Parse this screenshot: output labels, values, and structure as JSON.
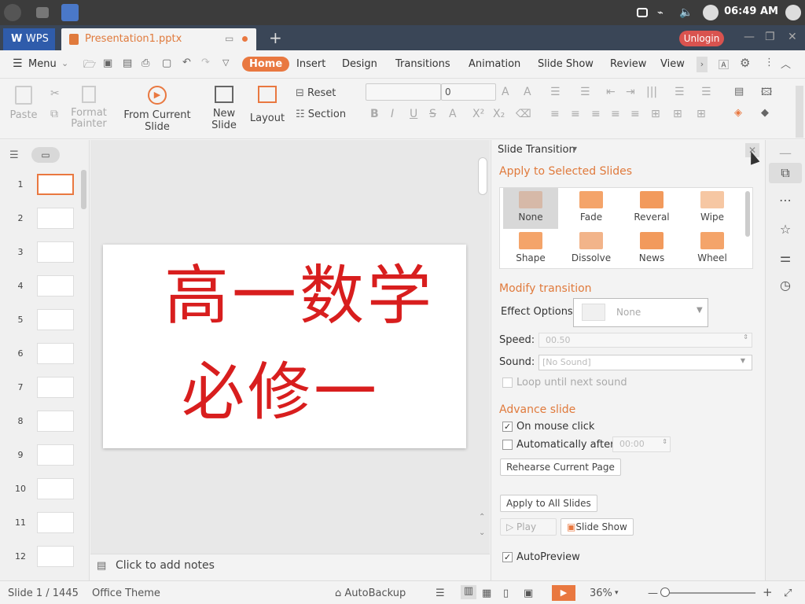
{
  "topbar": {
    "time": "06:49 AM"
  },
  "tabs": {
    "app": "WPS",
    "doc": "Presentation1.pptx",
    "unlogin": "Unlogin"
  },
  "menu": {
    "menu_label": "Menu",
    "tabs": [
      "Home",
      "Insert",
      "Design",
      "Transitions",
      "Animation",
      "Slide Show",
      "Review",
      "View"
    ]
  },
  "ribbon": {
    "paste": "Paste",
    "format_painter": "Format Painter",
    "from_current": "From Current Slide",
    "new_slide": "New Slide",
    "layout": "Layout",
    "reset": "Reset",
    "section": "Section",
    "font_size": "0"
  },
  "thumbnails": [
    "1",
    "2",
    "3",
    "4",
    "5",
    "6",
    "7",
    "8",
    "9",
    "10",
    "11",
    "12"
  ],
  "slide": {
    "line1": "高一数学",
    "line2": "必修一"
  },
  "notes": {
    "placeholder": "Click to add notes"
  },
  "panel": {
    "title": "Slide Transition",
    "apply_selected": "Apply to Selected Slides",
    "gallery": [
      {
        "label": "None",
        "color": "#d6b9a8"
      },
      {
        "label": "Fade",
        "color": "#f4a46a"
      },
      {
        "label": "Reveral",
        "color": "#f29a5c"
      },
      {
        "label": "Wipe",
        "color": "#f6c7a3"
      },
      {
        "label": "Shape",
        "color": "#f4a46a"
      },
      {
        "label": "Dissolve",
        "color": "#f2b48a"
      },
      {
        "label": "News",
        "color": "#f29a5c"
      },
      {
        "label": "Wheel",
        "color": "#f4a46a"
      }
    ],
    "modify": "Modify transition",
    "effect_label": "Effect Options:",
    "effect_value": "None",
    "speed_label": "Speed:",
    "speed_value": "00.50",
    "sound_label": "Sound:",
    "sound_value": "[No Sound]",
    "loop": "Loop until next sound",
    "advance": "Advance slide",
    "on_click": "On mouse click",
    "auto_after": "Automatically after",
    "auto_value": "00:00",
    "rehearse": "Rehearse Current Page",
    "apply_all": "Apply to All Slides",
    "play": "Play",
    "slide_show": "Slide Show",
    "autopreview": "AutoPreview"
  },
  "status": {
    "slide": "Slide 1 / 1445",
    "theme": "Office Theme",
    "autobackup": "AutoBackup",
    "zoom": "36%"
  },
  "colors": {
    "accent": "#e97840",
    "ink": "#d81e1e"
  }
}
